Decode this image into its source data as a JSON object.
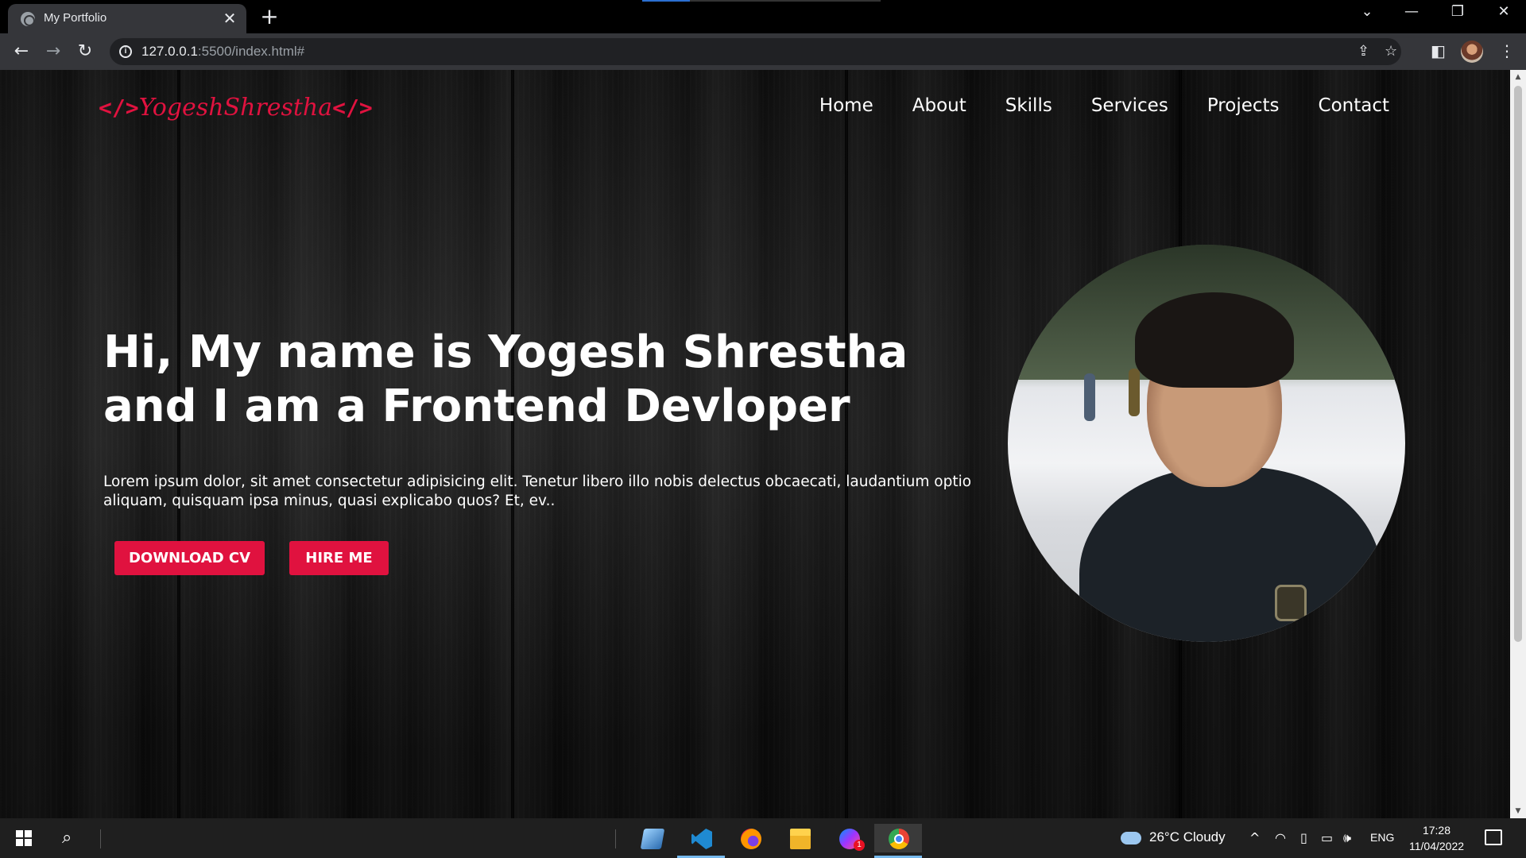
{
  "browser": {
    "tab_title": "My Portfolio",
    "new_tab_symbol": "+",
    "close_symbol": "✕",
    "url_host": "127.0.0.1",
    "url_path": ":5500/index.html#",
    "window_controls": {
      "collapse": "⌄",
      "minimize": "—",
      "restore": "❐",
      "close": "✕"
    },
    "nav": {
      "back": "←",
      "forward": "→",
      "reload": "↻"
    },
    "toolbar_icons": {
      "share": "⇪",
      "bookmark": "☆",
      "side_panel": "◧",
      "menu": "⋮"
    }
  },
  "site": {
    "logo_open_tag": "</>",
    "logo_text": "YogeshShrestha",
    "logo_close_tag": "</>",
    "accent_color": "#e0123f",
    "nav_items": [
      "Home",
      "About",
      "Skills",
      "Services",
      "Projects",
      "Contact"
    ],
    "hero": {
      "title_line1": "Hi, My name is Yogesh Shrestha",
      "title_line2": "and I am a Frontend Devloper",
      "text": "Lorem ipsum dolor, sit amet consectetur adipisicing elit. Tenetur libero illo nobis delectus obcaecati, laudantium optio aliquam, quisquam ipsa minus, quasi explicabo quos? Et, ev..",
      "download_cv_label": "DOWNLOAD CV",
      "hire_me_label": "HIRE ME"
    }
  },
  "taskbar": {
    "weather": "26°C  Cloudy",
    "language": "ENG",
    "time": "17:28",
    "date": "11/04/2022",
    "apps": [
      "files-app-icon",
      "vscode-icon",
      "firefox-icon",
      "file-explorer-icon",
      "messenger-icon",
      "chrome-icon"
    ],
    "tray_icons": {
      "chevron": "^",
      "network": "◠",
      "battery": "▭",
      "volume": "🕪"
    }
  }
}
